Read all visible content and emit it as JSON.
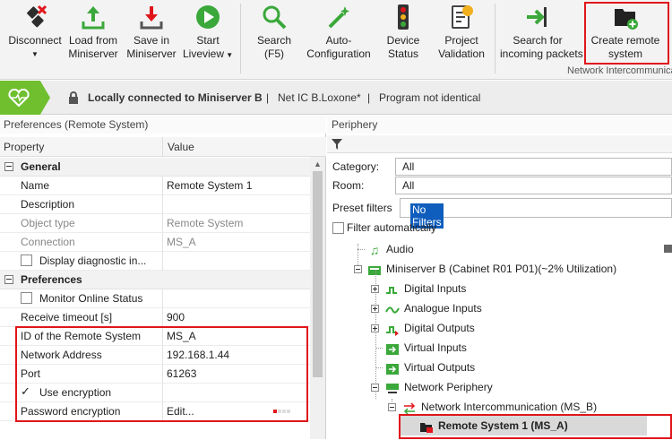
{
  "toolbar": {
    "disconnect": "Disconnect",
    "load_line1": "Load from",
    "load_line2": "Miniserver",
    "save_line1": "Save in",
    "save_line2": "Miniserver",
    "start_line1": "Start",
    "start_line2": "Liveview",
    "search_line1": "Search",
    "search_line2": "(F5)",
    "auto_line1": "Auto-",
    "auto_line2": "Configuration",
    "device_line1": "Device",
    "device_line2": "Status",
    "project_line1": "Project",
    "project_line2": "Validation",
    "searchfor_line1": "Search for",
    "searchfor_line2": "incoming packets",
    "create_line1": "Create remote",
    "create_line2": "system",
    "group_label": "Network Intercommunica"
  },
  "status": {
    "connection": "Locally connected to Miniserver B",
    "sep1": "|",
    "project": "Net IC B.Loxone*",
    "sep2": "|",
    "program": "Program not identical"
  },
  "preferences": {
    "title": "Preferences (Remote System)",
    "col_property": "Property",
    "col_value": "Value",
    "general_label": "General",
    "name_p": "Name",
    "name_v": "Remote System 1",
    "description_p": "Description",
    "objtype_p": "Object type",
    "objtype_v": "Remote System",
    "connection_p": "Connection",
    "connection_v": "MS_A",
    "diag_p": "Display diagnostic in...",
    "prefs_label": "Preferences",
    "monitor_p": "Monitor Online Status",
    "timeout_p": "Receive timeout [s]",
    "timeout_v": "900",
    "id_p": "ID of the Remote System",
    "id_v": "MS_A",
    "address_p": "Network Address",
    "address_v": "192.168.1.44",
    "port_p": "Port",
    "port_v": "61263",
    "encrypt_p": "Use encryption",
    "pwd_p": "Password encryption",
    "pwd_v": "Edit..."
  },
  "periphery": {
    "title": "Periphery",
    "category_label": "Category:",
    "category_value": "All",
    "room_label": "Room:",
    "room_value": "All",
    "preset_label": "Preset filters",
    "preset_value": "No Filters",
    "filter_auto": "Filter automatically",
    "tree": {
      "audio": "Audio",
      "miniserver": "Miniserver B (Cabinet R01 P01)(~2% Utilization)",
      "digital_inputs": "Digital Inputs",
      "analogue_inputs": "Analogue Inputs",
      "digital_outputs": "Digital Outputs",
      "virtual_inputs": "Virtual Inputs",
      "virtual_outputs": "Virtual Outputs",
      "network_periphery": "Network Periphery",
      "network_intercom": "Network Intercommunication (MS_B)",
      "remote_system": "Remote System 1  (MS_A)"
    }
  },
  "colors": {
    "accent_red": "#e0161b",
    "liveview_green": "#3aa83a",
    "status_green": "#6fbf2f",
    "selection_blue": "#0f5dbd"
  }
}
